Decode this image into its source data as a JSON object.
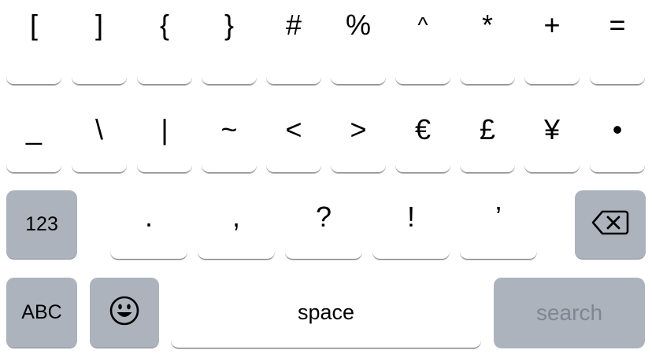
{
  "keyboard": {
    "row1": [
      "[",
      "]",
      "{",
      "}",
      "#",
      "%",
      "^",
      "*",
      "+",
      "="
    ],
    "row2": [
      "_",
      "\\",
      "|",
      "~",
      "<",
      ">",
      "€",
      "£",
      "¥",
      "•"
    ],
    "row3": [
      ".",
      ",",
      "?",
      "!",
      "’"
    ],
    "mode_key_label": "123",
    "abc_key_label": "ABC",
    "space_label": "space",
    "search_label": "search",
    "delete_icon": "backspace-icon",
    "emoji_icon": "emoji-smiley-icon"
  },
  "colors": {
    "key_bg": "#ffffff",
    "function_key_bg": "#adb3bd",
    "search_text": "#808591"
  }
}
